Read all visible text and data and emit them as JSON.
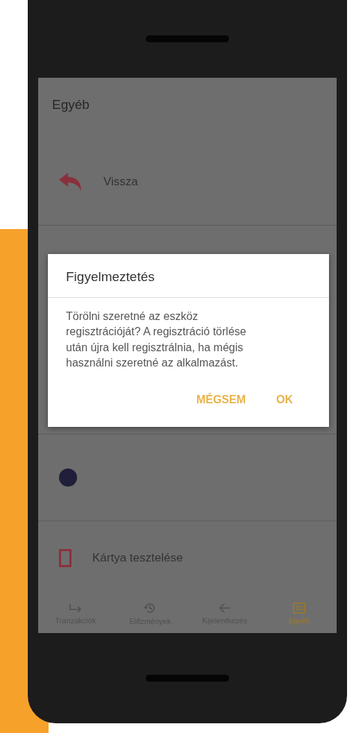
{
  "screen": {
    "title": "Egyéb"
  },
  "menu_items": [
    {
      "kind": "back",
      "label": "Vissza"
    },
    {
      "kind": "hidden"
    },
    {
      "kind": "circle"
    },
    {
      "kind": "card",
      "label": "Kártya tesztelése"
    }
  ],
  "dialog": {
    "title": "Figyelmeztetés",
    "message": "Törölni szeretné az eszköz regisztrációját? A regisztráció törlése után újra kell regisztrálnia, ha mégis használni szeretné az alkalmazást.",
    "buttons": [
      "MÉGSEM",
      "OK"
    ]
  },
  "bottom_nav": [
    {
      "kind": "transfer",
      "label": "Tranzakciók",
      "selected": false
    },
    {
      "kind": "history",
      "label": "Előzmények",
      "selected": false
    },
    {
      "kind": "logout",
      "label": "Kijelentkezés",
      "selected": false
    },
    {
      "kind": "other",
      "label": "Egyéb",
      "selected": true
    }
  ]
}
